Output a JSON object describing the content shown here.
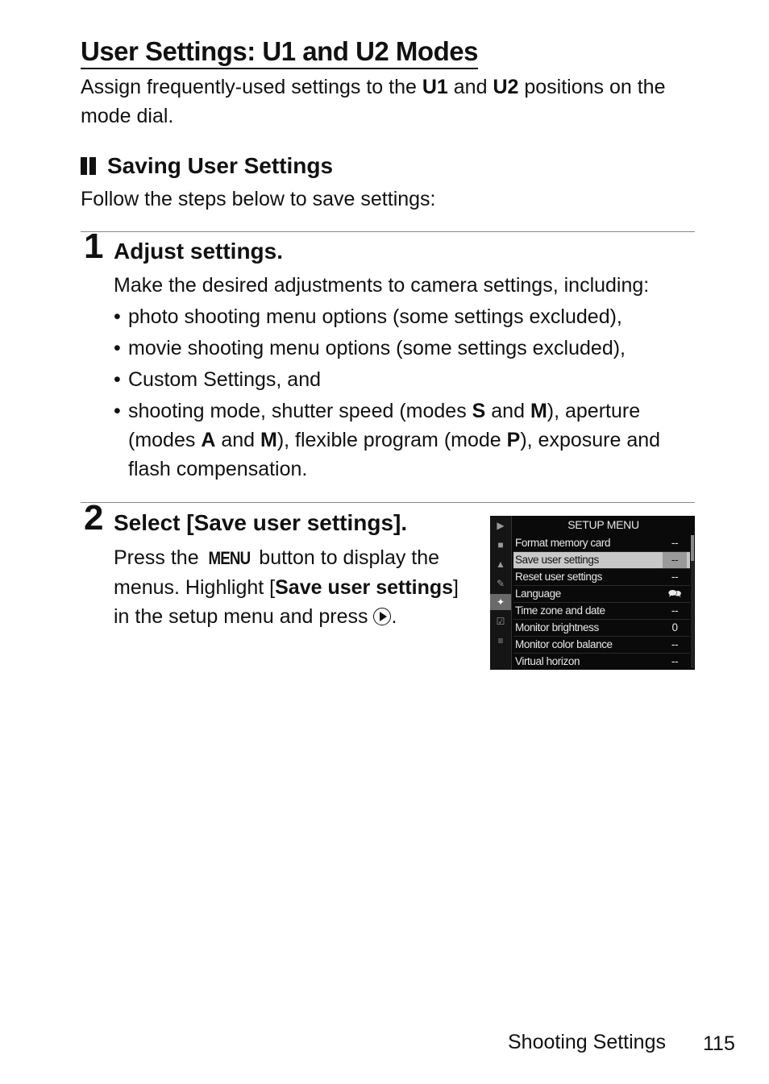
{
  "title": "User Settings: U1 and U2 Modes",
  "intro": {
    "pre": "Assign frequently-used settings to the ",
    "b1": "U1",
    "mid": " and ",
    "b2": "U2",
    "post": " positions on the mode dial."
  },
  "section": {
    "heading": "Saving User Settings",
    "lead": "Follow the steps below to save settings:"
  },
  "step1": {
    "number": "1",
    "title": "Adjust settings.",
    "lead": "Make the desired adjustments to camera settings, including:",
    "bullets": [
      "photo shooting menu options (some settings excluded),",
      "movie shooting menu options (some settings excluded),",
      "Custom Settings, and"
    ],
    "last_bullet": {
      "t1": "shooting mode, shutter speed (modes ",
      "b1": "S",
      "t2": " and ",
      "b2": "M",
      "t3": "), aperture (modes ",
      "b3": "A",
      "t4": " and ",
      "b4": "M",
      "t5": "), flexible program (mode ",
      "b5": "P",
      "t6": "), exposure and flash compensation."
    }
  },
  "step2": {
    "number": "2",
    "title": "Select [Save user settings].",
    "t1": "Press the ",
    "menu_button": "MENU",
    "t2": " button to display the menus. Highlight [",
    "bold": "Save user settings",
    "t3": "] in the setup menu and press ",
    "t4": "."
  },
  "camera_menu": {
    "title": "SETUP MENU",
    "side_icons": [
      "playback-icon",
      "photo-shooting-icon",
      "movie-shooting-icon",
      "custom-settings-icon",
      "setup-icon",
      "retouch-icon",
      "my-menu-icon"
    ],
    "active_side": "setup-icon",
    "items": [
      {
        "label": "Format memory card",
        "value": "--"
      },
      {
        "label": "Save user settings",
        "value": "--",
        "highlighted": true
      },
      {
        "label": "Reset user settings",
        "value": "--"
      },
      {
        "label": "Language",
        "value": "language-icon"
      },
      {
        "label": "Time zone and date",
        "value": "--"
      },
      {
        "label": "Monitor brightness",
        "value": "0"
      },
      {
        "label": "Monitor color balance",
        "value": "--"
      },
      {
        "label": "Virtual horizon",
        "value": "--"
      }
    ]
  },
  "footer": {
    "section": "Shooting Settings",
    "page": "115"
  }
}
